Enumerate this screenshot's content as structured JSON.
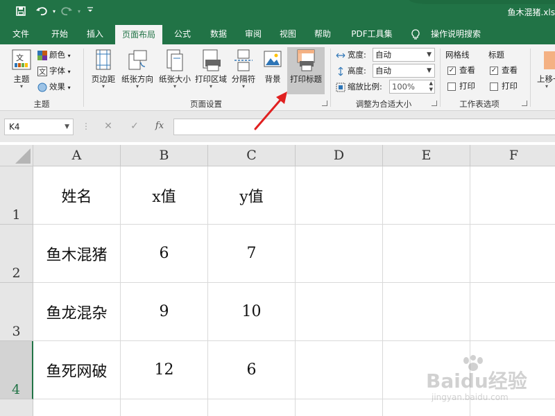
{
  "titlebar": {
    "doc_title": "鱼木混猪.xls",
    "save_icon": "save-icon",
    "undo_icon": "undo-icon",
    "redo_icon": "redo-icon",
    "customize_icon": "customize-qat-icon"
  },
  "tabs": [
    {
      "label": "文件"
    },
    {
      "label": "开始"
    },
    {
      "label": "插入"
    },
    {
      "label": "页面布局"
    },
    {
      "label": "公式"
    },
    {
      "label": "数据"
    },
    {
      "label": "审阅"
    },
    {
      "label": "视图"
    },
    {
      "label": "帮助"
    },
    {
      "label": "PDF工具集"
    },
    {
      "label": "操作说明搜索"
    }
  ],
  "ribbon": {
    "themes": {
      "group_label": "主题",
      "theme_btn": "主题",
      "colors": "颜色",
      "fonts": "字体",
      "effects": "效果"
    },
    "page_setup": {
      "group_label": "页面设置",
      "margins": "页边距",
      "orientation": "纸张方向",
      "size": "纸张大小",
      "print_area": "打印区域",
      "breaks": "分隔符",
      "background": "背景",
      "print_titles": "打印标题"
    },
    "scale": {
      "group_label": "调整为合适大小",
      "width_label": "宽度:",
      "width_value": "自动",
      "height_label": "高度:",
      "height_value": "自动",
      "scale_label": "缩放比例:",
      "scale_value": "100%"
    },
    "sheet_options": {
      "group_label": "工作表选项",
      "gridlines_head": "网格线",
      "headings_head": "标题",
      "view": "查看",
      "print": "打印",
      "gridlines_view_checked": true,
      "gridlines_print_checked": false,
      "headings_view_checked": true,
      "headings_print_checked": false
    },
    "arrange": {
      "bring_forward": "上移一"
    }
  },
  "formula_bar": {
    "name_box": "K4",
    "fx": "fx",
    "content": ""
  },
  "grid": {
    "columns": [
      "A",
      "B",
      "C",
      "D",
      "E",
      "F"
    ],
    "rows": [
      {
        "num": "1",
        "cells": [
          "姓名",
          "x值",
          "y值",
          "",
          "",
          ""
        ]
      },
      {
        "num": "2",
        "cells": [
          "鱼木混猪",
          "6",
          "7",
          "",
          "",
          ""
        ]
      },
      {
        "num": "3",
        "cells": [
          "鱼龙混杂",
          "9",
          "10",
          "",
          "",
          ""
        ]
      },
      {
        "num": "4",
        "cells": [
          "鱼死网破",
          "12",
          "6",
          "",
          "",
          ""
        ]
      }
    ],
    "selected_row": "4"
  },
  "watermark": {
    "main": "Baidu经验",
    "sub": "jingyan.baidu.com"
  },
  "accent_color": "#217346",
  "annotation_color": "#e02020"
}
